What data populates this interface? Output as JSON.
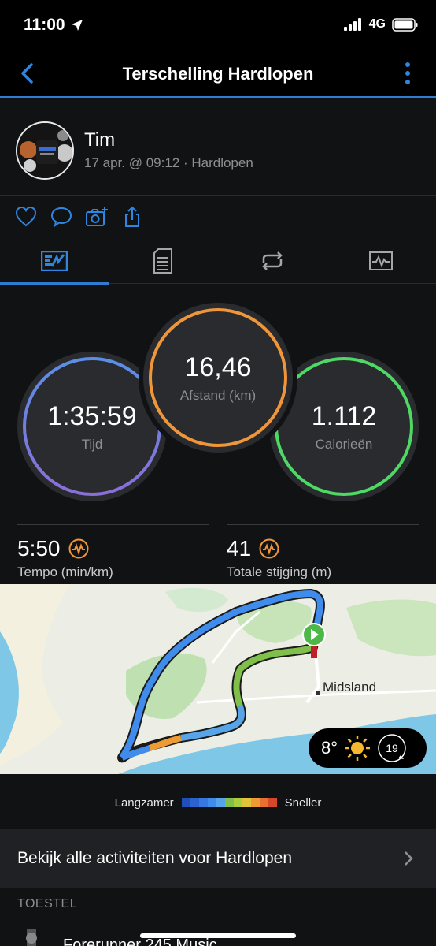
{
  "status_bar": {
    "time": "11:00",
    "network": "4G"
  },
  "nav": {
    "title": "Terschelling Hardlopen"
  },
  "user": {
    "name": "Tim",
    "meta": "17 apr. @ 09:12 · Hardlopen"
  },
  "social_icons": [
    "heart-icon",
    "comment-icon",
    "add-photo-icon",
    "share-icon"
  ],
  "tabs": [
    {
      "name": "overview",
      "icon": "stats-overview-icon",
      "active": true
    },
    {
      "name": "laps",
      "icon": "laps-list-icon",
      "active": false
    },
    {
      "name": "splits",
      "icon": "repeat-icon",
      "active": false
    },
    {
      "name": "charts",
      "icon": "activity-chart-icon",
      "active": false
    }
  ],
  "rings": {
    "time": {
      "value": "1:35:59",
      "label": "Tijd",
      "color": "#5b8ee8"
    },
    "distance": {
      "value": "16,46",
      "label": "Afstand (km)",
      "color": "#f0963a"
    },
    "calories": {
      "value": "1.112",
      "label": "Calorieën",
      "color": "#4cd964"
    }
  },
  "metrics": {
    "pace": {
      "value": "5:50",
      "label": "Tempo (min/km)"
    },
    "ascent": {
      "value": "41",
      "label": "Totale stijging (m)"
    }
  },
  "map": {
    "place": "Midsland",
    "temperature": "8°",
    "wind": "19"
  },
  "legend": {
    "slower": "Langzamer",
    "faster": "Sneller",
    "colors": [
      "#1f4fb8",
      "#2a63d0",
      "#3478e0",
      "#3f8cec",
      "#57a4e8",
      "#7fbf4a",
      "#a7cf3e",
      "#e2c43a",
      "#ef9b34",
      "#e9702e",
      "#d9472a"
    ]
  },
  "list": {
    "all_activities": "Bekijk alle activiteiten voor Hardlopen"
  },
  "device": {
    "section": "TOESTEL",
    "name": "Forerunner 245 Music"
  }
}
